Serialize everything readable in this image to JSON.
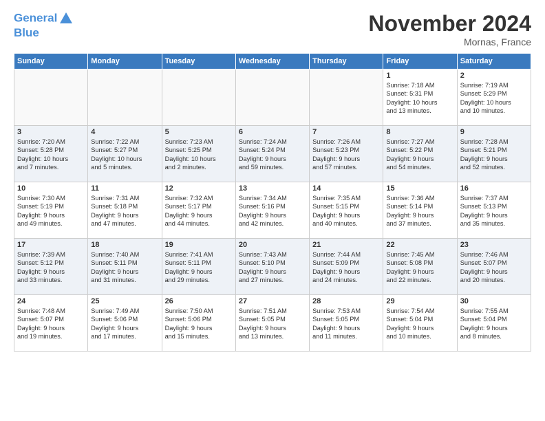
{
  "header": {
    "logo_line1": "General",
    "logo_line2": "Blue",
    "month": "November 2024",
    "location": "Mornas, France"
  },
  "columns": [
    "Sunday",
    "Monday",
    "Tuesday",
    "Wednesday",
    "Thursday",
    "Friday",
    "Saturday"
  ],
  "weeks": [
    [
      {
        "day": "",
        "info": ""
      },
      {
        "day": "",
        "info": ""
      },
      {
        "day": "",
        "info": ""
      },
      {
        "day": "",
        "info": ""
      },
      {
        "day": "",
        "info": ""
      },
      {
        "day": "1",
        "info": "Sunrise: 7:18 AM\nSunset: 5:31 PM\nDaylight: 10 hours\nand 13 minutes."
      },
      {
        "day": "2",
        "info": "Sunrise: 7:19 AM\nSunset: 5:29 PM\nDaylight: 10 hours\nand 10 minutes."
      }
    ],
    [
      {
        "day": "3",
        "info": "Sunrise: 7:20 AM\nSunset: 5:28 PM\nDaylight: 10 hours\nand 7 minutes."
      },
      {
        "day": "4",
        "info": "Sunrise: 7:22 AM\nSunset: 5:27 PM\nDaylight: 10 hours\nand 5 minutes."
      },
      {
        "day": "5",
        "info": "Sunrise: 7:23 AM\nSunset: 5:25 PM\nDaylight: 10 hours\nand 2 minutes."
      },
      {
        "day": "6",
        "info": "Sunrise: 7:24 AM\nSunset: 5:24 PM\nDaylight: 9 hours\nand 59 minutes."
      },
      {
        "day": "7",
        "info": "Sunrise: 7:26 AM\nSunset: 5:23 PM\nDaylight: 9 hours\nand 57 minutes."
      },
      {
        "day": "8",
        "info": "Sunrise: 7:27 AM\nSunset: 5:22 PM\nDaylight: 9 hours\nand 54 minutes."
      },
      {
        "day": "9",
        "info": "Sunrise: 7:28 AM\nSunset: 5:21 PM\nDaylight: 9 hours\nand 52 minutes."
      }
    ],
    [
      {
        "day": "10",
        "info": "Sunrise: 7:30 AM\nSunset: 5:19 PM\nDaylight: 9 hours\nand 49 minutes."
      },
      {
        "day": "11",
        "info": "Sunrise: 7:31 AM\nSunset: 5:18 PM\nDaylight: 9 hours\nand 47 minutes."
      },
      {
        "day": "12",
        "info": "Sunrise: 7:32 AM\nSunset: 5:17 PM\nDaylight: 9 hours\nand 44 minutes."
      },
      {
        "day": "13",
        "info": "Sunrise: 7:34 AM\nSunset: 5:16 PM\nDaylight: 9 hours\nand 42 minutes."
      },
      {
        "day": "14",
        "info": "Sunrise: 7:35 AM\nSunset: 5:15 PM\nDaylight: 9 hours\nand 40 minutes."
      },
      {
        "day": "15",
        "info": "Sunrise: 7:36 AM\nSunset: 5:14 PM\nDaylight: 9 hours\nand 37 minutes."
      },
      {
        "day": "16",
        "info": "Sunrise: 7:37 AM\nSunset: 5:13 PM\nDaylight: 9 hours\nand 35 minutes."
      }
    ],
    [
      {
        "day": "17",
        "info": "Sunrise: 7:39 AM\nSunset: 5:12 PM\nDaylight: 9 hours\nand 33 minutes."
      },
      {
        "day": "18",
        "info": "Sunrise: 7:40 AM\nSunset: 5:11 PM\nDaylight: 9 hours\nand 31 minutes."
      },
      {
        "day": "19",
        "info": "Sunrise: 7:41 AM\nSunset: 5:11 PM\nDaylight: 9 hours\nand 29 minutes."
      },
      {
        "day": "20",
        "info": "Sunrise: 7:43 AM\nSunset: 5:10 PM\nDaylight: 9 hours\nand 27 minutes."
      },
      {
        "day": "21",
        "info": "Sunrise: 7:44 AM\nSunset: 5:09 PM\nDaylight: 9 hours\nand 24 minutes."
      },
      {
        "day": "22",
        "info": "Sunrise: 7:45 AM\nSunset: 5:08 PM\nDaylight: 9 hours\nand 22 minutes."
      },
      {
        "day": "23",
        "info": "Sunrise: 7:46 AM\nSunset: 5:07 PM\nDaylight: 9 hours\nand 20 minutes."
      }
    ],
    [
      {
        "day": "24",
        "info": "Sunrise: 7:48 AM\nSunset: 5:07 PM\nDaylight: 9 hours\nand 19 minutes."
      },
      {
        "day": "25",
        "info": "Sunrise: 7:49 AM\nSunset: 5:06 PM\nDaylight: 9 hours\nand 17 minutes."
      },
      {
        "day": "26",
        "info": "Sunrise: 7:50 AM\nSunset: 5:06 PM\nDaylight: 9 hours\nand 15 minutes."
      },
      {
        "day": "27",
        "info": "Sunrise: 7:51 AM\nSunset: 5:05 PM\nDaylight: 9 hours\nand 13 minutes."
      },
      {
        "day": "28",
        "info": "Sunrise: 7:53 AM\nSunset: 5:05 PM\nDaylight: 9 hours\nand 11 minutes."
      },
      {
        "day": "29",
        "info": "Sunrise: 7:54 AM\nSunset: 5:04 PM\nDaylight: 9 hours\nand 10 minutes."
      },
      {
        "day": "30",
        "info": "Sunrise: 7:55 AM\nSunset: 5:04 PM\nDaylight: 9 hours\nand 8 minutes."
      }
    ]
  ]
}
